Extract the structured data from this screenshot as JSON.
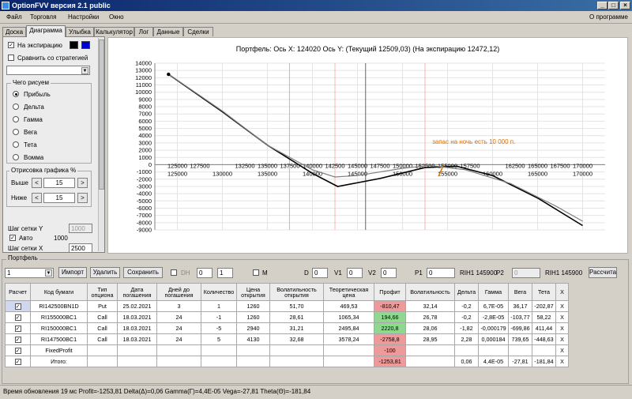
{
  "window": {
    "title": "OptionFVV версия 2.1 public"
  },
  "menu": {
    "items": [
      "Файл",
      "Торговля",
      "Настройки",
      "Окно"
    ],
    "about": "О программе"
  },
  "tabs": [
    "Доска",
    "Диаграмма",
    "Улыбка",
    "Калькулятор",
    "Лог",
    "Данные",
    "Сделки"
  ],
  "left": {
    "at_expiry": "На экспирацию",
    "compare": "Сравнить со стратегией",
    "what_to_draw": "Чего рисуем",
    "options": [
      "Прибыль",
      "Дельта",
      "Гамма",
      "Вега",
      "Тета",
      "Вомма"
    ],
    "draw_group": "Отрисовка графика %",
    "above_label": "Выше",
    "above_value": "15",
    "below_label": "Ниже",
    "below_value": "15",
    "grid_y_label": "Шаг сетки Y",
    "grid_y_value": "1000",
    "auto_label": "Авто",
    "auto_value": "1000",
    "grid_x_label": "Шаг сетки X",
    "grid_x_value": "2500",
    "colors": [
      "#000000",
      "#0000cc"
    ]
  },
  "chart_data": {
    "type": "line",
    "title": "Портфель: Ось X: 124020 Ось Y: (Текущий 12509,03) (На экспирацию 12472,12)",
    "annotation": "запас на ночь есть 10 000 п.",
    "x_ticks_top": [
      "125000",
      "127500",
      "132500",
      "135000",
      "137500",
      "140000",
      "142500",
      "145000",
      "147500",
      "150000",
      "152500",
      "155000",
      "157500",
      "162500",
      "165000",
      "167500",
      "170000"
    ],
    "x_ticks_bottom": [
      "125000",
      "130000",
      "135000",
      "140000",
      "145000",
      "150000",
      "155000",
      "160000",
      "165000",
      "170000"
    ],
    "y_ticks": [
      "14000",
      "13000",
      "12000",
      "11000",
      "10000",
      "9000",
      "8000",
      "7000",
      "6000",
      "5000",
      "4000",
      "3000",
      "2000",
      "1000",
      "0",
      "-1000",
      "-2000",
      "-3000",
      "-4000",
      "-5000",
      "-6000",
      "-7000",
      "-8000",
      "-9000"
    ],
    "xlim": [
      122500,
      172500
    ],
    "ylim": [
      -9000,
      14000
    ],
    "series": [
      {
        "color": "#000000",
        "x": [
          124020,
          130000,
          135000,
          140000,
          142800,
          147500,
          152500,
          156000,
          160000,
          165000,
          170000
        ],
        "y": [
          12472,
          7300,
          2700,
          -1200,
          -3000,
          -1900,
          -400,
          -200,
          -1500,
          -4600,
          -8400
        ]
      },
      {
        "color": "#808080",
        "x": [
          124020,
          130000,
          135000,
          140000,
          142500,
          145000,
          150000,
          153000,
          157000,
          162000,
          167000,
          170000
        ],
        "y": [
          12509,
          7400,
          2700,
          -700,
          -1700,
          -1500,
          -500,
          -100,
          -700,
          -2600,
          -5700,
          -7800
        ]
      }
    ]
  },
  "portfolio": {
    "label": "Портфель",
    "selector": "1",
    "import": "Импорт",
    "delete": "Удалить",
    "save": "Сохранить",
    "dh": "DH",
    "dh_a": "0",
    "dh_b": "1",
    "m": "M",
    "d_label": "D",
    "d_val": "0",
    "v1_label": "V1",
    "v1_val": "0",
    "v2_label": "V2",
    "v2_val": "0",
    "p1_label": "P1",
    "p1_val": "0",
    "p1_code": "RIH1 145900",
    "p2_label": "P2",
    "p2_val": "0",
    "p2_code": "RIH1 145900",
    "calc": "Рассчитать"
  },
  "table": {
    "headers": [
      "Расчет",
      "Код бумаги",
      "Тип опциона",
      "Дата погашения",
      "Дней до погашения",
      "Количество",
      "Цена открытия",
      "Волатильность открытия",
      "Теоретическая цена",
      "Профит",
      "Волатильность",
      "Дельта",
      "Гамма",
      "Вега",
      "Тета",
      "X"
    ],
    "rows": [
      [
        "",
        "RI142500BN1D",
        "Put",
        "25.02.2021",
        "3",
        "1",
        "1260",
        "51,70",
        "469,53",
        "-810,47",
        "32,14",
        "-0,2",
        "6,7E-05",
        "36,17",
        "-202,87",
        "X"
      ],
      [
        "",
        "RI155000BC1",
        "Call",
        "18.03.2021",
        "24",
        "-1",
        "1260",
        "28,61",
        "1065,34",
        "194,66",
        "26,78",
        "-0,2",
        "-2,8E-05",
        "-103,77",
        "58,22",
        "X"
      ],
      [
        "",
        "RI150000BC1",
        "Call",
        "18.03.2021",
        "24",
        "-5",
        "2940",
        "31,21",
        "2495,84",
        "2220,8",
        "28,06",
        "-1,82",
        "-0,000179",
        "-699,86",
        "411,44",
        "X"
      ],
      [
        "",
        "RI147500BC1",
        "Call",
        "18.03.2021",
        "24",
        "5",
        "4130",
        "32,68",
        "3578,24",
        "-2758,8",
        "28,95",
        "2,28",
        "0,000184",
        "739,65",
        "-448,63",
        "X"
      ],
      [
        "",
        "FixedProfit",
        "",
        "",
        "",
        "",
        "",
        "",
        "",
        "-100",
        "",
        "",
        "",
        "",
        "",
        "X"
      ],
      [
        "",
        "Итого:",
        "",
        "",
        "",
        "",
        "",
        "",
        "",
        "-1253,81",
        "",
        "0,06",
        "4,4E-05",
        "-27,81",
        "-181,84",
        "X"
      ]
    ]
  },
  "status": "Время обновления 19 мс  Profit=-1253,81 Delta(Δ)=0,06 Gamma(Γ)=4,4E-05 Vega=-27,81 Theta(Θ)=-181,84"
}
